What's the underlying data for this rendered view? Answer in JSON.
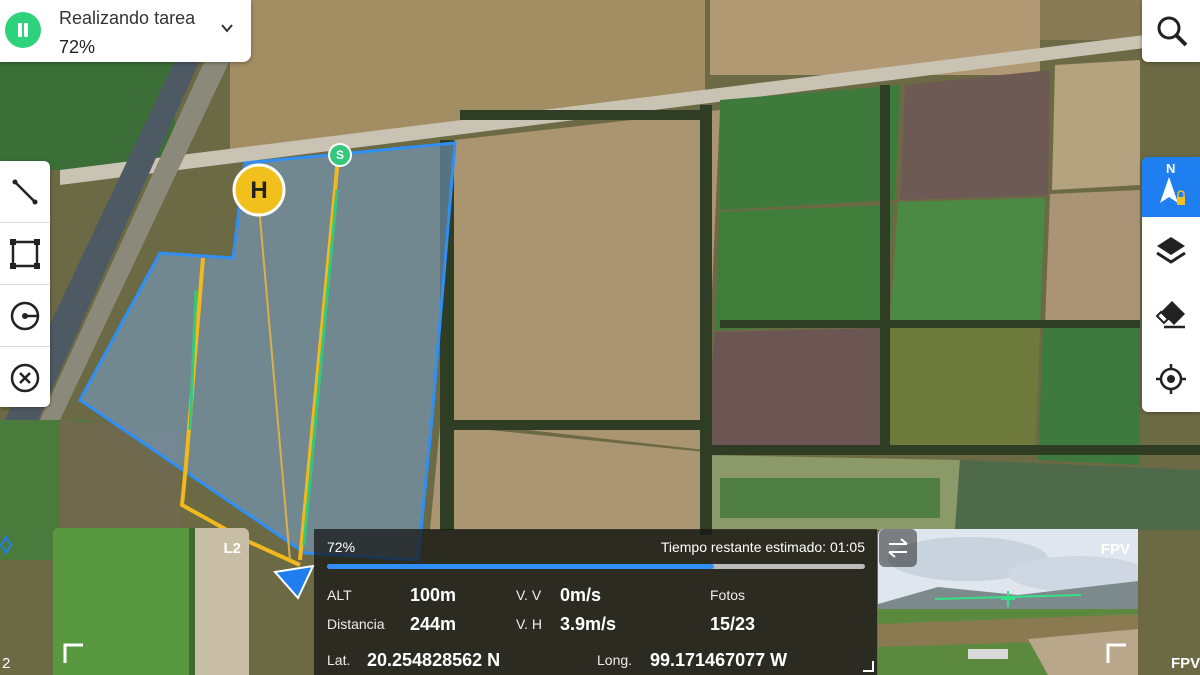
{
  "status": {
    "title": "Realizando tarea",
    "percent": "72%"
  },
  "tools_left": [
    "line-tool",
    "rectangle-tool",
    "orbit-tool",
    "clear-tool"
  ],
  "tools_right": [
    "compass-lock",
    "layers",
    "eraser",
    "locate"
  ],
  "map": {
    "home_label": "H",
    "start_label": "S",
    "compass_label": "N",
    "corner_label": "2"
  },
  "mini_map": {
    "label": "L2"
  },
  "telemetry": {
    "progress_label": "72%",
    "progress_value": 0.72,
    "eta_label": "Tiempo restante estimado: 01:05",
    "alt_label": "ALT",
    "alt_value": "100m",
    "vv_label": "V. V",
    "vv_value": "0m/s",
    "photos_label": "Fotos",
    "photos_value": "15/23",
    "distance_label": "Distancia",
    "distance_value": "244m",
    "vh_label": "V. H",
    "vh_value": "3.9m/s",
    "lat_label": "Lat.",
    "lat_value": "20.254828562 N",
    "long_label": "Long.",
    "long_value": "99.171467077 W"
  },
  "fpv": {
    "label": "FPV"
  },
  "colors": {
    "accent": "#1f7ef0",
    "pause_green": "#2ed27a",
    "route_green": "#35c77b",
    "route_yellow": "#f2b81c",
    "area_outline": "#2f8ff5"
  }
}
